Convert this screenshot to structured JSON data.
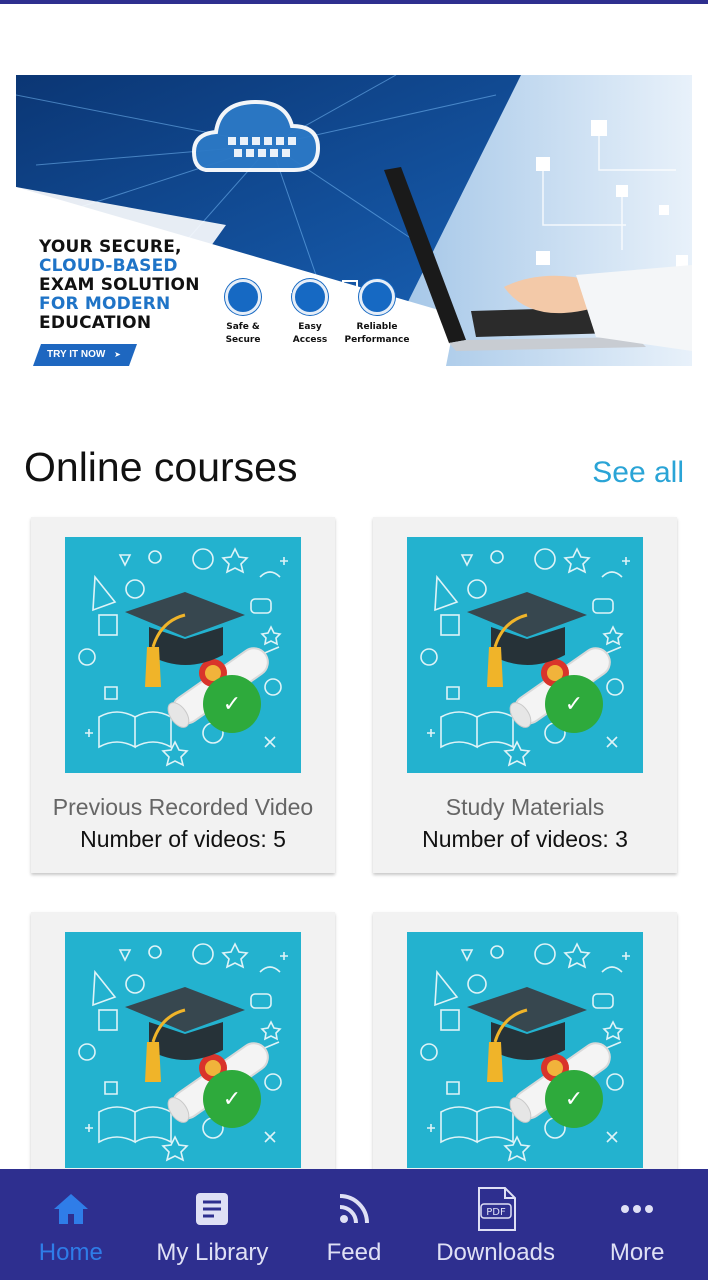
{
  "banner": {
    "headline_lines": [
      {
        "text": "YOUR SECURE,",
        "style": "dark"
      },
      {
        "text": "CLOUD-BASED",
        "style": "blue"
      },
      {
        "text": "EXAM SOLUTION",
        "style": "dark"
      },
      {
        "text": "FOR MODERN",
        "style": "blue"
      },
      {
        "text": "EDUCATION",
        "style": "dark"
      }
    ],
    "cta_label": "TRY IT NOW",
    "cta_arrow": "➤",
    "features": [
      {
        "icon": "shield-icon",
        "line1": "Safe &",
        "line2": "Secure"
      },
      {
        "icon": "monitor-lock-icon",
        "line1": "Easy",
        "line2": "Access"
      },
      {
        "icon": "network-icon",
        "line1": "Reliable",
        "line2": "Performance"
      }
    ]
  },
  "section": {
    "title": "Online courses",
    "see_all": "See all"
  },
  "courses": [
    {
      "title": "Previous Recorded Video",
      "subtitle": "Number of videos: 5",
      "completed": true
    },
    {
      "title": "Study Materials",
      "subtitle": "Number of videos: 3",
      "completed": true
    },
    {
      "title": "",
      "subtitle": "",
      "completed": true
    },
    {
      "title": "",
      "subtitle": "",
      "completed": true
    }
  ],
  "nav": {
    "items": [
      {
        "label": "Home",
        "icon": "home-icon",
        "active": true
      },
      {
        "label": "My Library",
        "icon": "library-icon",
        "active": false
      },
      {
        "label": "Feed",
        "icon": "rss-feed-icon",
        "active": false
      },
      {
        "label": "Downloads",
        "icon": "pdf-download-icon",
        "active": false
      },
      {
        "label": "More",
        "icon": "more-dots-icon",
        "active": false
      }
    ]
  },
  "colors": {
    "primary": "#2e2f8f",
    "accent": "#2aa4d6",
    "active_nav": "#2f7de8",
    "check": "#2eaa3c",
    "thumb_bg": "#23b2cf"
  }
}
